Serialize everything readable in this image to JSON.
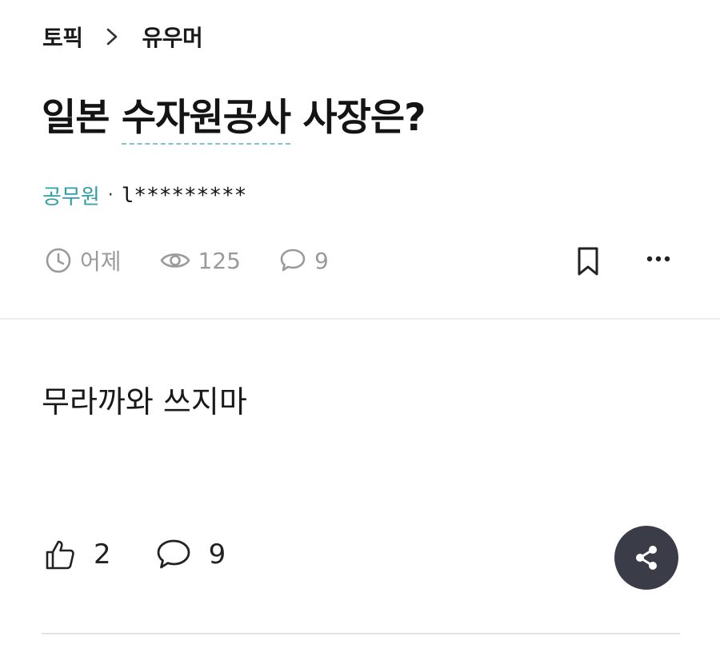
{
  "breadcrumb": {
    "topic": "토픽",
    "category": "유우머"
  },
  "post": {
    "title_prefix": "일본 ",
    "title_highlight": "수자원공사",
    "title_suffix": " 사장은?",
    "author_org": "공무원",
    "author_separator": "·",
    "author_nick": "l*********",
    "time": "어제",
    "views": "125",
    "comment_count": "9",
    "body": "무라까와 쓰지마",
    "likes": "2",
    "comments_bottom": "9"
  },
  "colors": {
    "accent": "#2f9fa6",
    "highlight_underline": "#7fc6cc",
    "meta_gray": "#9a9a9a",
    "share_bg": "#3a3d47"
  },
  "icons": {
    "breadcrumb_separator": "chevron-right-icon",
    "time": "clock-icon",
    "views": "eye-icon",
    "comments": "speech-bubble-icon",
    "bookmark": "bookmark-icon",
    "more": "more-horizontal-icon",
    "like": "thumbs-up-icon",
    "share": "share-icon"
  }
}
